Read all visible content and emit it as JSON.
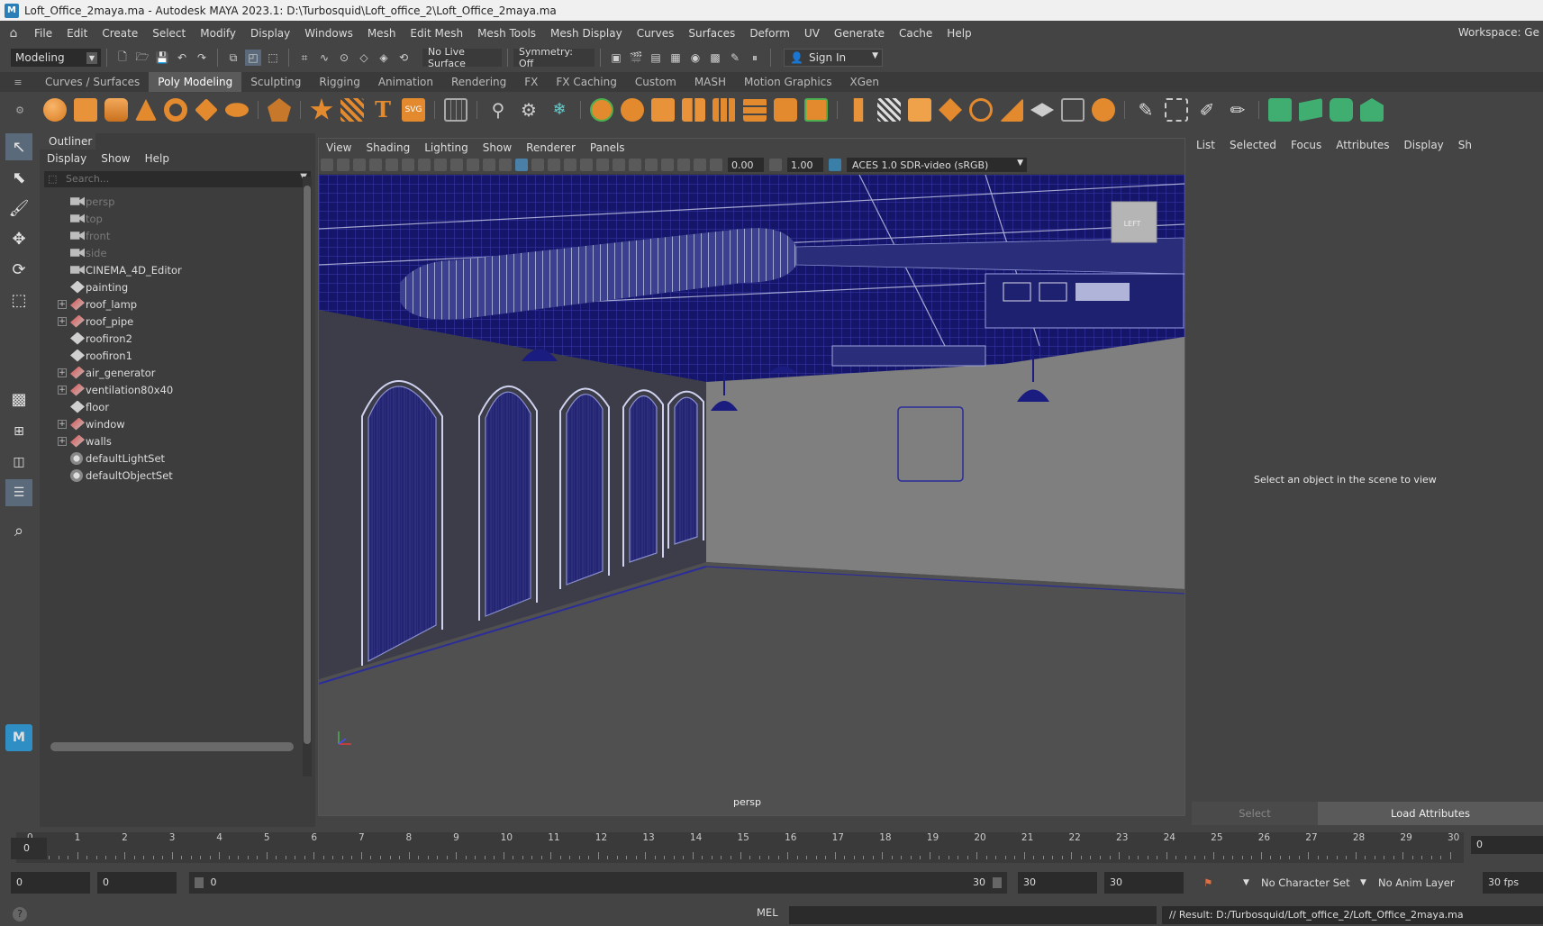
{
  "window": {
    "title": "Loft_Office_2maya.ma - Autodesk MAYA 2023.1: D:\\Turbosquid\\Loft_office_2\\Loft_Office_2maya.ma"
  },
  "menubar": {
    "items": [
      "File",
      "Edit",
      "Create",
      "Select",
      "Modify",
      "Display",
      "Windows",
      "Mesh",
      "Edit Mesh",
      "Mesh Tools",
      "Mesh Display",
      "Curves",
      "Surfaces",
      "Deform",
      "UV",
      "Generate",
      "Cache",
      "Help"
    ],
    "workspace": "Workspace: Ge"
  },
  "statusline": {
    "mode": "Modeling",
    "live_surface": "No Live Surface",
    "symmetry": "Symmetry: Off",
    "sign_in": "Sign In"
  },
  "shelf": {
    "tabs": [
      "Curves / Surfaces",
      "Poly Modeling",
      "Sculpting",
      "Rigging",
      "Animation",
      "Rendering",
      "FX",
      "FX Caching",
      "Custom",
      "MASH",
      "Motion Graphics",
      "XGen"
    ],
    "active_tab": "Poly Modeling"
  },
  "outliner": {
    "title": "Outliner",
    "menu": [
      "Display",
      "Show",
      "Help"
    ],
    "search_placeholder": "Search...",
    "items": [
      {
        "label": "persp",
        "type": "camera",
        "dim": true,
        "expand": false
      },
      {
        "label": "top",
        "type": "camera",
        "dim": true,
        "expand": false
      },
      {
        "label": "front",
        "type": "camera",
        "dim": true,
        "expand": false
      },
      {
        "label": "side",
        "type": "camera",
        "dim": true,
        "expand": false
      },
      {
        "label": "CINEMA_4D_Editor",
        "type": "camera",
        "dim": false,
        "expand": false
      },
      {
        "label": "painting",
        "type": "mesh",
        "dim": false,
        "expand": false
      },
      {
        "label": "roof_lamp",
        "type": "group",
        "dim": false,
        "expand": true
      },
      {
        "label": "roof_pipe",
        "type": "group",
        "dim": false,
        "expand": true
      },
      {
        "label": "roofiron2",
        "type": "mesh",
        "dim": false,
        "expand": false
      },
      {
        "label": "roofiron1",
        "type": "mesh",
        "dim": false,
        "expand": false
      },
      {
        "label": "air_generator",
        "type": "group",
        "dim": false,
        "expand": true
      },
      {
        "label": "ventilation80x40",
        "type": "group",
        "dim": false,
        "expand": true
      },
      {
        "label": "floor",
        "type": "mesh",
        "dim": false,
        "expand": false
      },
      {
        "label": "window",
        "type": "group",
        "dim": false,
        "expand": true
      },
      {
        "label": "walls",
        "type": "group",
        "dim": false,
        "expand": true
      },
      {
        "label": "defaultLightSet",
        "type": "set",
        "dim": false,
        "expand": false
      },
      {
        "label": "defaultObjectSet",
        "type": "set",
        "dim": false,
        "expand": false
      }
    ]
  },
  "viewport": {
    "menu": [
      "View",
      "Shading",
      "Lighting",
      "Show",
      "Renderer",
      "Panels"
    ],
    "exposure": "0.00",
    "gamma": "1.00",
    "colorspace": "ACES 1.0 SDR-video (sRGB)",
    "camera_label": "persp",
    "viewcube_label": "LEFT"
  },
  "attribute_editor": {
    "menu": [
      "List",
      "Selected",
      "Focus",
      "Attributes",
      "Display",
      "Sh"
    ],
    "hint": "Select an object in the scene to view",
    "select_button": "Select",
    "load_button": "Load Attributes"
  },
  "timeslider": {
    "current_frame": "0",
    "frame_field": "0",
    "ticks": [
      "0",
      "1",
      "2",
      "3",
      "4",
      "5",
      "6",
      "7",
      "8",
      "9",
      "10",
      "11",
      "12",
      "13",
      "14",
      "15",
      "16",
      "17",
      "18",
      "19",
      "20",
      "21",
      "22",
      "23",
      "24",
      "25",
      "26",
      "27",
      "28",
      "29",
      "30"
    ]
  },
  "range": {
    "start": "0",
    "anim_start": "0",
    "slider_start": "0",
    "slider_end": "30",
    "anim_end": "30",
    "end": "30",
    "character_set": "No Character Set",
    "anim_layer": "No Anim Layer",
    "fps": "30 fps"
  },
  "cmdline": {
    "mel": "MEL",
    "result": "// Result: D:/Turbosquid/Loft_office_2/Loft_Office_2maya.ma"
  }
}
